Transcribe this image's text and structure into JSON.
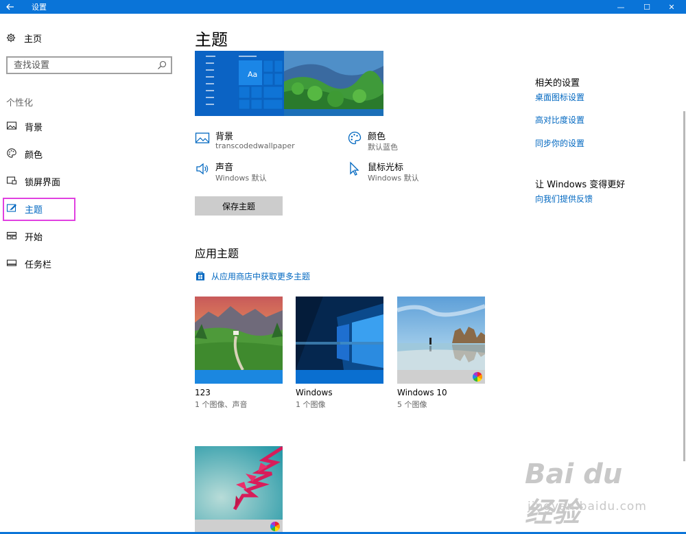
{
  "window": {
    "title": "设置",
    "minimize": "—",
    "maximize": "☐",
    "close": "✕"
  },
  "sidebar": {
    "home_label": "主页",
    "search_placeholder": "查找设置",
    "section_label": "个性化",
    "items": [
      {
        "label": "背景",
        "icon": "picture-icon"
      },
      {
        "label": "颜色",
        "icon": "palette-icon"
      },
      {
        "label": "锁屏界面",
        "icon": "lockscreen-icon"
      },
      {
        "label": "主题",
        "icon": "theme-brush-icon",
        "active": true
      },
      {
        "label": "开始",
        "icon": "start-icon"
      },
      {
        "label": "任务栏",
        "icon": "taskbar-icon"
      }
    ]
  },
  "main": {
    "title": "主题",
    "preview_sample_text": "Aa",
    "properties": [
      {
        "name": "背景",
        "value": "transcodedwallpaper",
        "icon": "picture-icon"
      },
      {
        "name": "颜色",
        "value": "默认蓝色",
        "icon": "palette-icon"
      },
      {
        "name": "声音",
        "value": "Windows 默认",
        "icon": "speaker-icon"
      },
      {
        "name": "鼠标光标",
        "value": "Windows 默认",
        "icon": "cursor-icon"
      }
    ],
    "save_button": "保存主题",
    "apply_title": "应用主题",
    "store_link": "从应用商店中获取更多主题",
    "themes": [
      {
        "name": "123",
        "sub": "1 个图像、声音",
        "bar_color": "#1b87e0",
        "wheel": false
      },
      {
        "name": "Windows",
        "sub": "1 个图像",
        "bar_color": "#0a6fd0",
        "wheel": false
      },
      {
        "name": "Windows 10",
        "sub": "5 个图像",
        "bar_color": "#cfcfcf",
        "wheel": true
      },
      {
        "name": "",
        "sub": "",
        "bar_color": "#cfcfcf",
        "wheel": true
      }
    ]
  },
  "related": {
    "title": "相关的设置",
    "links": [
      "桌面图标设置",
      "高对比度设置",
      "同步你的设置"
    ],
    "improve_title": "让 Windows 变得更好",
    "feedback_link": "向我们提供反馈"
  },
  "watermark": {
    "line1": "Bai du 经验",
    "line2": "jingyan.baidu.com"
  },
  "colors": {
    "accent": "#0a74d8",
    "link": "#0067c0",
    "highlight_box": "#e040e0"
  }
}
